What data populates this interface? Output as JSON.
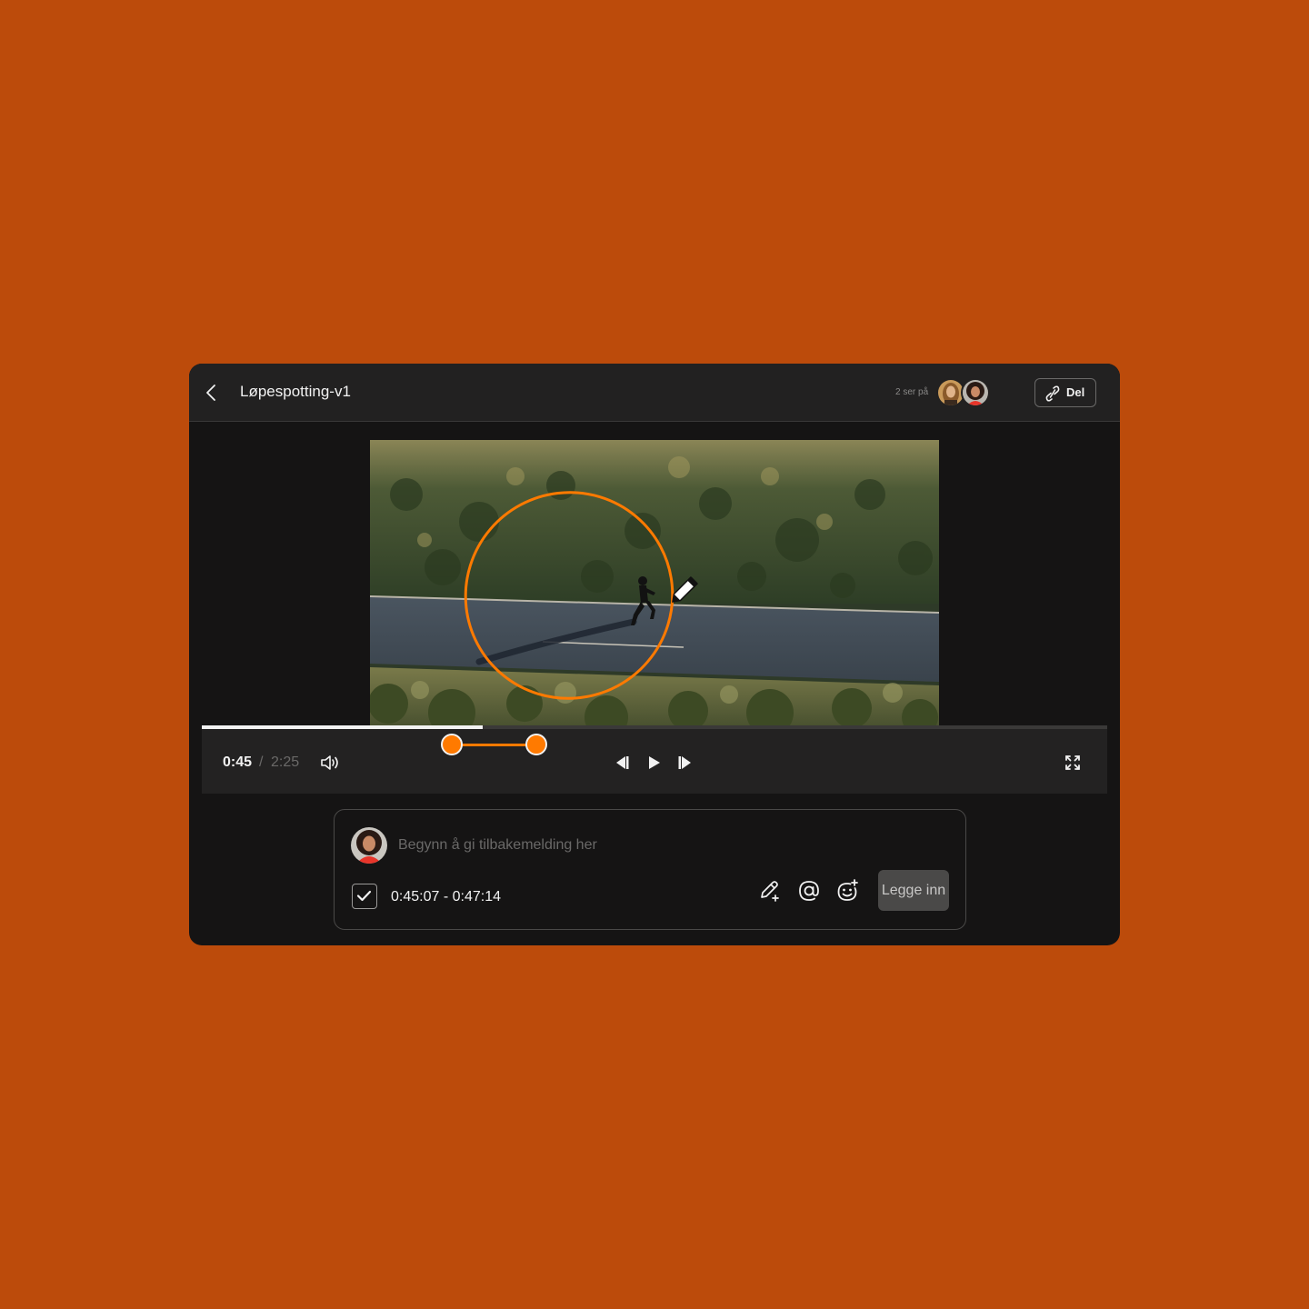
{
  "header": {
    "title": "Løpespotting-v1",
    "viewers_label": "2 ser på",
    "share_label": "Del"
  },
  "player": {
    "current_time": "0:45",
    "separator": "/",
    "total_time": "2:25",
    "progress_fraction": 0.31,
    "range_start_fraction": 0.31,
    "range_end_fraction": 0.4
  },
  "comment": {
    "placeholder": "Begynn å gi tilbakemelding her",
    "time_range": "0:45:07 - 0:47:14",
    "submit_label": "Legge inn"
  },
  "colors": {
    "accent": "#ff7a00",
    "background": "#bc4b0b"
  }
}
